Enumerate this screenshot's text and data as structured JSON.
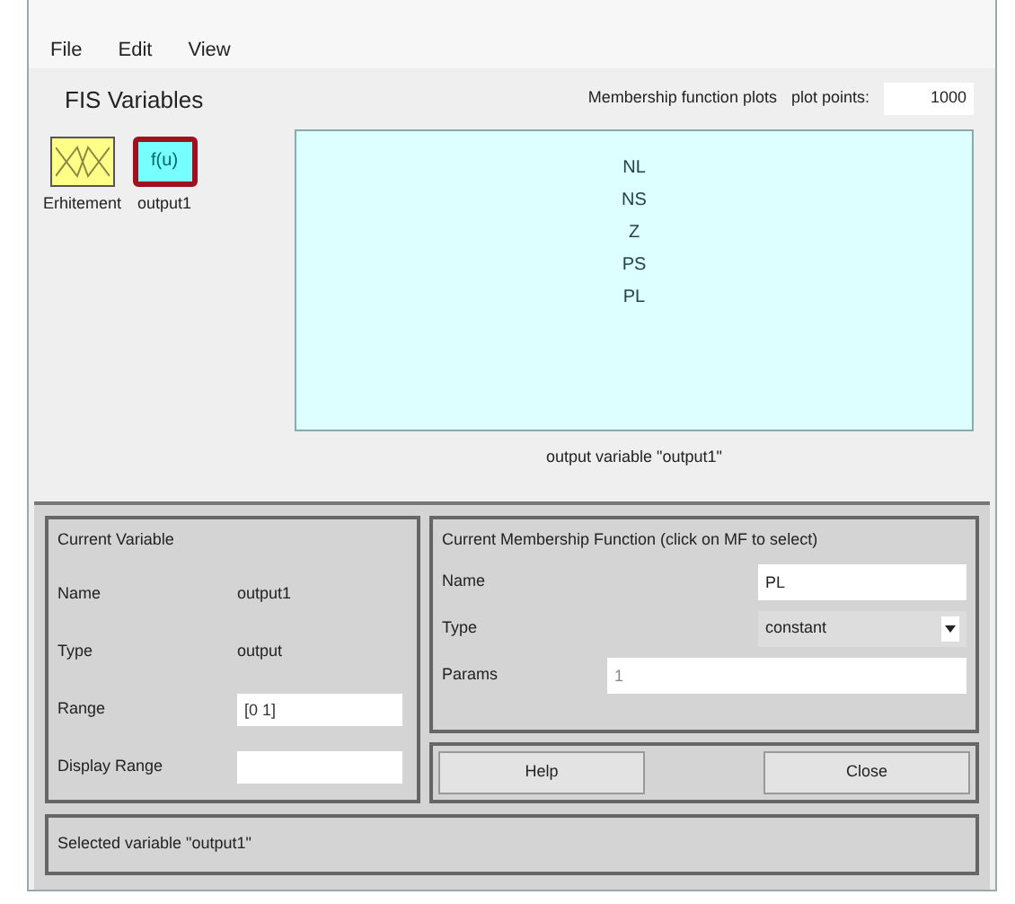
{
  "menu": [
    "File",
    "Edit",
    "View"
  ],
  "fis_variables": {
    "title": "FIS Variables",
    "variables": [
      {
        "kind": "input",
        "label": "Erhitement",
        "selected": false
      },
      {
        "kind": "output",
        "label": "output1",
        "icon_text": "f(u)",
        "selected": true
      }
    ]
  },
  "plot": {
    "title": "Membership function plots",
    "plot_points_label": "plot points:",
    "plot_points": "1000",
    "mf_labels": [
      "NL",
      "NS",
      "Z",
      "PS",
      "PL"
    ],
    "caption": "output variable \"output1\""
  },
  "current_variable": {
    "title": "Current Variable",
    "rows": [
      {
        "kind": "text",
        "label": "Name",
        "value": "output1"
      },
      {
        "kind": "text",
        "label": "Type",
        "value": "output"
      },
      {
        "kind": "field",
        "label": "Range",
        "value": "[0 1]"
      },
      {
        "kind": "field",
        "label": "Display Range"
      }
    ]
  },
  "current_mf": {
    "title": "Current Membership Function (click on MF to select)",
    "name_label": "Name",
    "name": "PL",
    "type_label": "Type",
    "type": "constant",
    "params_label": "Params",
    "params": "1"
  },
  "buttons": [
    "Help",
    "Close"
  ],
  "status": "Selected variable \"output1\""
}
